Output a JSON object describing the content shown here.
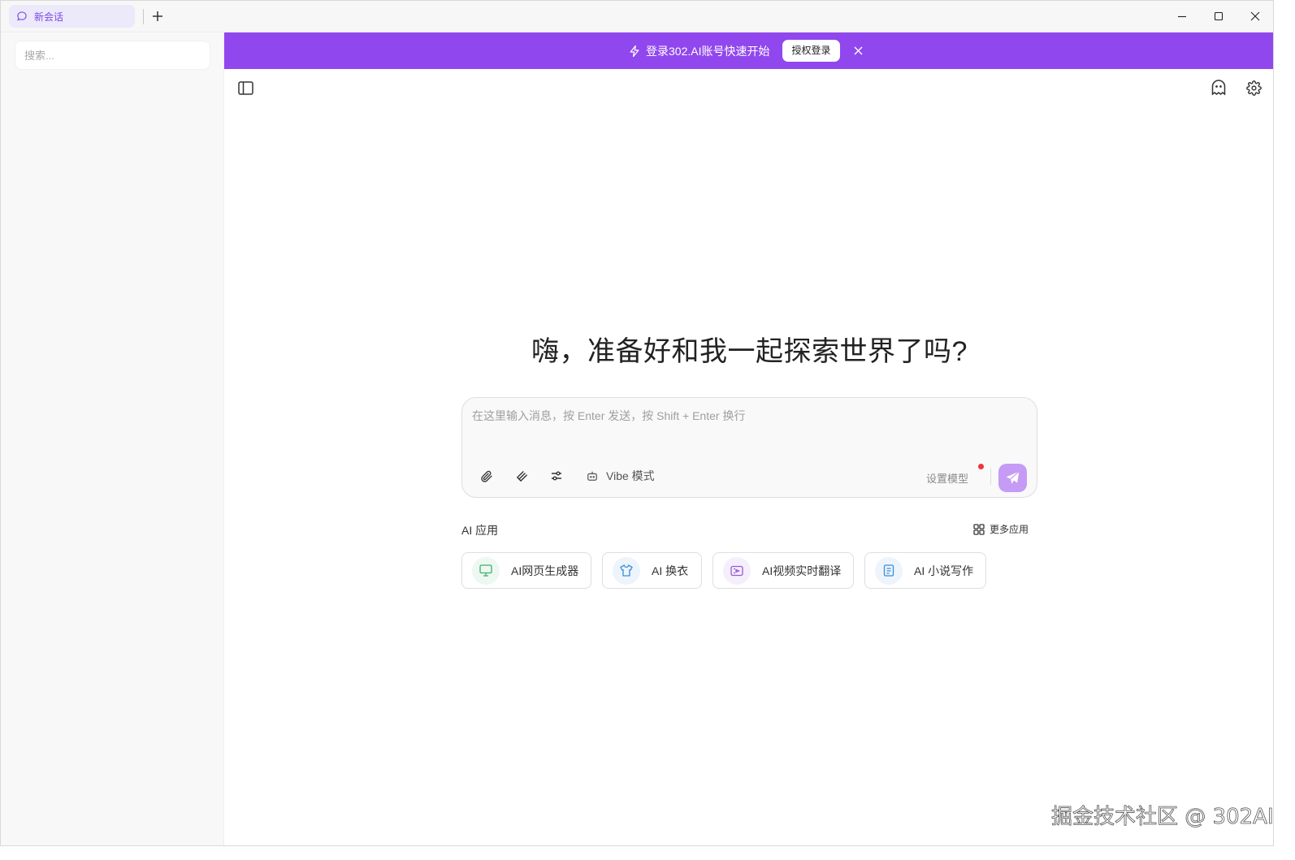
{
  "titlebar": {
    "tab_label": "新会话",
    "new_tab_icon": "plus-icon"
  },
  "sidebar": {
    "search_placeholder": "搜索..."
  },
  "banner": {
    "text": "登录302.AI账号快速开始",
    "button_label": "授权登录",
    "bg_color": "#9147ee"
  },
  "main": {
    "greeting": "嗨，准备好和我一起探索世界了吗?",
    "composer": {
      "placeholder": "在这里输入消息，按 Enter 发送，按 Shift + Enter 换行",
      "vibe_label": "Vibe 模式",
      "set_model_label": "设置模型"
    },
    "apps": {
      "title": "AI 应用",
      "more_label": "更多应用",
      "items": [
        {
          "label": "AI网页生成器",
          "icon": "monitor-icon",
          "color": "#3fae6a"
        },
        {
          "label": "AI 换衣",
          "icon": "shirt-icon",
          "color": "#3b8fd9"
        },
        {
          "label": "AI视频实时翻译",
          "icon": "video-icon",
          "color": "#9b59d6"
        },
        {
          "label": "AI 小说写作",
          "icon": "book-icon",
          "color": "#3b8fd9"
        }
      ]
    }
  },
  "watermark": "掘金技术社区 @ 302AI"
}
